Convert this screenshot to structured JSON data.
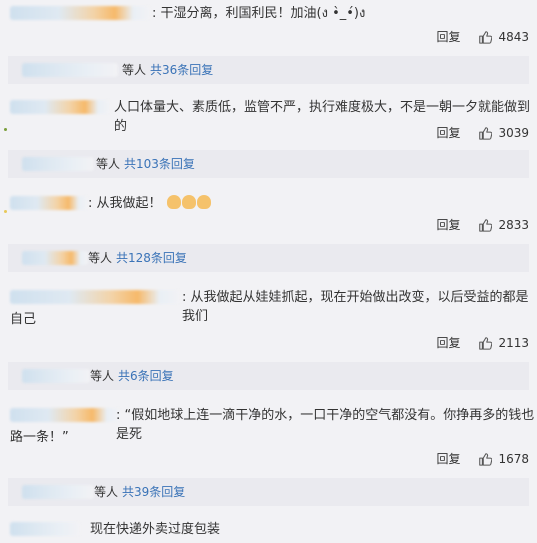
{
  "comments": [
    {
      "text": ": 干湿分离，利国利民！加油(ง •̀_•́)ง",
      "reply_label": "回复",
      "likes": "4843",
      "sub_users_suffix": "等人",
      "sub_count_label": "共36条回复"
    },
    {
      "text": "人口体量大、素质低，监管不严，执行难度极大，不是一朝一夕就能做到的",
      "reply_label": "回复",
      "likes": "3039",
      "sub_users_suffix": "等人",
      "sub_count_label": "共103条回复"
    },
    {
      "text": ": 从我做起！",
      "reply_label": "回复",
      "likes": "2833",
      "sub_users_suffix": "等人",
      "sub_count_label": "共128条回复"
    },
    {
      "text_line1": ": 从我做起从娃娃抓起，现在开始做出改变，以后受益的都是我们",
      "text_line2": "自己",
      "reply_label": "回复",
      "likes": "2113",
      "sub_users_suffix": "等人",
      "sub_count_label": "共6条回复"
    },
    {
      "text_line1": ": “假如地球上连一滴干净的水，一口干净的空气都没有。你挣再多的钱也是死",
      "text_line2": "路一条！”",
      "reply_label": "回复",
      "likes": "1678",
      "sub_users_suffix": "等人",
      "sub_count_label": "共39条回复"
    },
    {
      "text": "现在快递外卖过度包装"
    }
  ],
  "icons": {
    "like": "thumbs-up-icon",
    "emoji": "muscle-emoji-icon"
  },
  "colors": {
    "link": "#3a73b7",
    "background": "#f2f2f5",
    "subbox": "#eaeaef"
  }
}
